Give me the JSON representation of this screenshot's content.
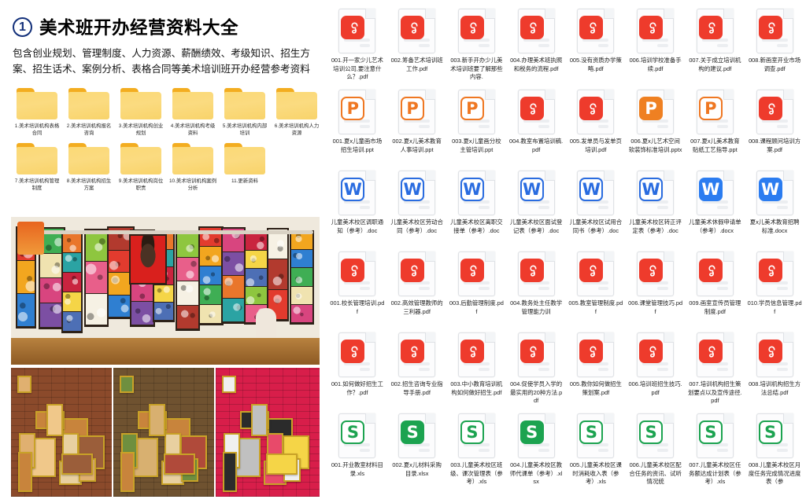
{
  "header": {
    "number": "1",
    "title": "美术班开办经营资料大全",
    "subtitle": "包含创业规划、管理制度、人力资源、薪酬绩效、考级知识、招生方案、招生话术、案例分析、表格合同等美术培训班开办经营参考资料"
  },
  "folders": [
    {
      "label": "1.美术培训机构表格合同"
    },
    {
      "label": "2.美术培训机构报名咨询"
    },
    {
      "label": "3.美术培训机构创业规划"
    },
    {
      "label": "4.美术培训机构考级资料"
    },
    {
      "label": "5.美术培训机构内部培训"
    },
    {
      "label": "6.美术培训机构人力资源"
    },
    {
      "label": "7.美术培训机构管理制度"
    },
    {
      "label": "8.美术培训机构招生方案"
    },
    {
      "label": "9.美术培训机构岗位职责"
    },
    {
      "label": "10.美术培训机构案例分析"
    },
    {
      "label": "11.更新资料"
    }
  ],
  "collage": {
    "top_alt": "美术教室墙面作品展示",
    "b1_alt": "砖墙画廊走廊",
    "b2_alt": "绿色画廊展墙",
    "b3_alt": "红色展板儿童画"
  },
  "files": [
    [
      {
        "label": "001.开一家少儿艺术培训公司,要注意什么？.pdf",
        "icon": "pdf-icon",
        "type": "pdf"
      },
      {
        "label": "002.筹备艺术培训班工作.pdf",
        "icon": "pdf-icon",
        "type": "pdf"
      },
      {
        "label": "003.新手开办少儿美术培训班要了解那些内容.",
        "icon": "pdf-icon",
        "type": "pdf"
      },
      {
        "label": "004.办理美术班执照和税务的流程.pdf",
        "icon": "pdf-icon",
        "type": "pdf"
      },
      {
        "label": "005.没有资质办学策略.pdf",
        "icon": "pdf-icon",
        "type": "pdf"
      },
      {
        "label": "006.培训学校准备手续.pdf",
        "icon": "pdf-icon",
        "type": "pdf"
      },
      {
        "label": "007.关于成立培训机构的建议.pdf",
        "icon": "pdf-icon",
        "type": "pdf"
      },
      {
        "label": "008.新画室开业市场调查.pdf",
        "icon": "pdf-icon",
        "type": "pdf"
      }
    ],
    [
      {
        "label": "001.夏x儿童画市场招生培训.ppt",
        "icon": "ppt-icon",
        "type": "ppt"
      },
      {
        "label": "002.夏x儿美术教育人事培训.ppt",
        "icon": "ppt-icon",
        "type": "ppt"
      },
      {
        "label": "003.夏x儿童画分校主管培训.ppt",
        "icon": "ppt-icon",
        "type": "ppt"
      },
      {
        "label": "004.教室布置培训稿.pdf",
        "icon": "pdf-icon",
        "type": "pdf"
      },
      {
        "label": "005.发单员与发单页培训.pdf",
        "icon": "pdf-icon",
        "type": "pdf"
      },
      {
        "label": "006.夏x儿艺术空间软装饰标准培训.pptx",
        "icon": "ppt-filled-icon",
        "type": "pptf"
      },
      {
        "label": "007.夏x儿美术教育贴纸工艺指导.ppt",
        "icon": "ppt-icon",
        "type": "ppt"
      },
      {
        "label": "008.课程顾问培训方案.pdf",
        "icon": "pdf-icon",
        "type": "pdf"
      }
    ],
    [
      {
        "label": "儿童美术校区调职通知（参考）.doc",
        "icon": "word-icon",
        "type": "doc"
      },
      {
        "label": "儿童美术校区劳动合同（参考）.doc",
        "icon": "word-icon",
        "type": "doc"
      },
      {
        "label": "儿童美术校区离职交接单（参考）.doc",
        "icon": "word-icon",
        "type": "doc"
      },
      {
        "label": "儿童美术校区面试登记表（参考）.doc",
        "icon": "word-icon",
        "type": "doc"
      },
      {
        "label": "儿童美术校区试用合同书（参考）.doc",
        "icon": "word-icon",
        "type": "doc"
      },
      {
        "label": "儿童美术校区转正评定表（参考）.doc",
        "icon": "word-icon",
        "type": "doc"
      },
      {
        "label": "儿童美术休假申请单（参考）.docx",
        "icon": "word-filled-icon",
        "type": "docf"
      },
      {
        "label": "夏x儿美术教育招聘标准.docx",
        "icon": "word-filled-icon",
        "type": "docf"
      }
    ],
    [
      {
        "label": "001.校长管理培训.pdf",
        "icon": "pdf-icon",
        "type": "pdf"
      },
      {
        "label": "002.高效管理教师的三利器.pdf",
        "icon": "pdf-icon",
        "type": "pdf"
      },
      {
        "label": "003.后勤管理制度.pdf",
        "icon": "pdf-icon",
        "type": "pdf"
      },
      {
        "label": "004.教务处主任教学管理能力训",
        "icon": "pdf-icon",
        "type": "pdf"
      },
      {
        "label": "005.教室管理制度.pdf",
        "icon": "pdf-icon",
        "type": "pdf"
      },
      {
        "label": "006.课堂管理技巧.pdf",
        "icon": "pdf-icon",
        "type": "pdf"
      },
      {
        "label": "009.画室宣传员管理制度.pdf",
        "icon": "pdf-icon",
        "type": "pdf"
      },
      {
        "label": "010.学员信息管理.pdf",
        "icon": "pdf-icon",
        "type": "pdf"
      }
    ],
    [
      {
        "label": "001.如何做好招生工作？.pdf",
        "icon": "pdf-icon",
        "type": "pdf"
      },
      {
        "label": "002.招生咨询专业指导手册.pdf",
        "icon": "pdf-icon",
        "type": "pdf"
      },
      {
        "label": "003.中小教育培训机构如何做好招生.pdf",
        "icon": "pdf-icon",
        "type": "pdf"
      },
      {
        "label": "004.促使学员入学的最实用的20种方法.pdf",
        "icon": "pdf-icon",
        "type": "pdf"
      },
      {
        "label": "005.教你如何做招生策划案.pdf",
        "icon": "pdf-icon",
        "type": "pdf"
      },
      {
        "label": "006.培训班招生技巧.pdf",
        "icon": "pdf-icon",
        "type": "pdf"
      },
      {
        "label": "007.培训机构招生策划要点以及宣传途径.pdf",
        "icon": "pdf-icon",
        "type": "pdf"
      },
      {
        "label": "008.培训机构招生方法总结.pdf",
        "icon": "pdf-icon",
        "type": "pdf"
      }
    ],
    [
      {
        "label": "001.开业教室材料目录.xls",
        "icon": "excel-icon",
        "type": "xls"
      },
      {
        "label": "002.夏x儿材料采购目录.xlsx",
        "icon": "excel-filled-icon",
        "type": "xlsf"
      },
      {
        "label": "003.儿童美术校区班级、课次管理表（参考）.xls",
        "icon": "excel-icon",
        "type": "xls"
      },
      {
        "label": "004.儿童美术校区教师代课单（参考）.xlsx",
        "icon": "excel-filled-icon",
        "type": "xlsf"
      },
      {
        "label": "005.儿童美术校区课时消耗收入表（参考）.xls",
        "icon": "excel-icon",
        "type": "xls"
      },
      {
        "label": "006.儿童美术校区配合任务的资讯、试听情况统",
        "icon": "excel-icon",
        "type": "xls"
      },
      {
        "label": "007.儿童美术校区任务额达成计划表（参考）.xls",
        "icon": "excel-icon",
        "type": "xls"
      },
      {
        "label": "008.儿童美术校区月度任务完成情况进度表（参",
        "icon": "excel-icon",
        "type": "xls"
      }
    ]
  ],
  "icon_glyphs": {
    "pdf": "P",
    "ppt": "P",
    "doc": "W",
    "xls": "S"
  },
  "colors": {
    "pdf": "#ee3b2c",
    "ppt": "#ef7722",
    "doc": "#2a6ce0",
    "xls": "#1ca350",
    "folder": "#fbd976",
    "title": "#000000",
    "circle": "#13307a"
  }
}
